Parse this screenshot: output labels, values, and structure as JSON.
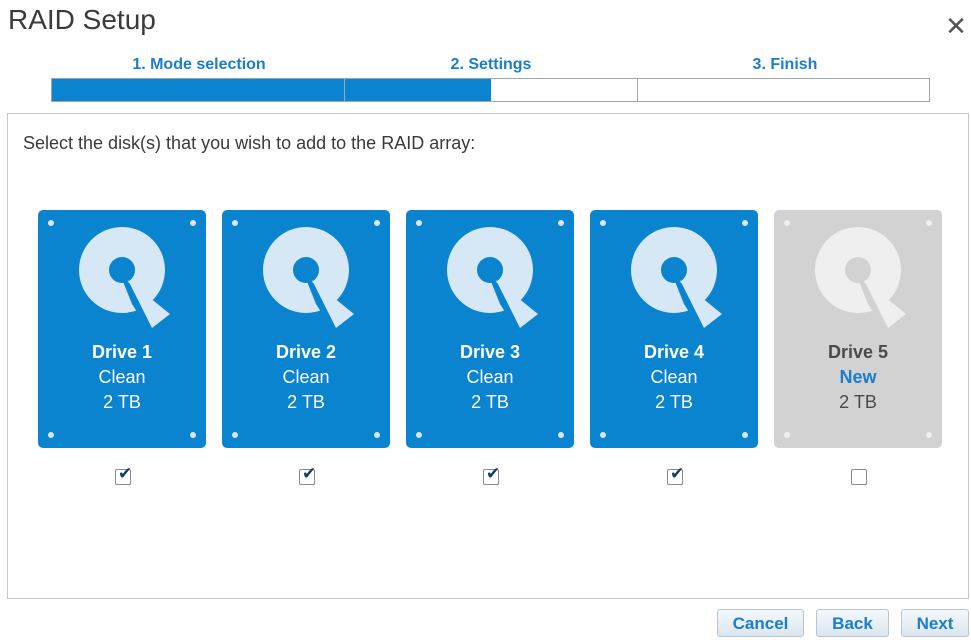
{
  "dialog": {
    "title": "RAID Setup"
  },
  "steps": [
    {
      "label": "1. Mode selection"
    },
    {
      "label": "2. Settings"
    },
    {
      "label": "3. Finish"
    }
  ],
  "progress": {
    "fraction_complete": 0.5
  },
  "instruction": "Select the disk(s) that you wish to add to the RAID array:",
  "drives": [
    {
      "name": "Drive 1",
      "status": "Clean",
      "size": "2 TB",
      "checked": true,
      "color": "#0a84cf"
    },
    {
      "name": "Drive 2",
      "status": "Clean",
      "size": "2 TB",
      "checked": true,
      "color": "#0a84cf"
    },
    {
      "name": "Drive 3",
      "status": "Clean",
      "size": "2 TB",
      "checked": true,
      "color": "#0a84cf"
    },
    {
      "name": "Drive 4",
      "status": "Clean",
      "size": "2 TB",
      "checked": true,
      "color": "#0a84cf"
    },
    {
      "name": "Drive 5",
      "status": "New",
      "size": "2 TB",
      "checked": false,
      "color": "#d2d2d2"
    }
  ],
  "buttons": {
    "cancel": "Cancel",
    "back": "Back",
    "next": "Next"
  },
  "colors": {
    "accent": "#0a84cf",
    "link": "#1a7ecb",
    "checkmark": "#123e66"
  },
  "icons": {
    "close": "close-icon",
    "drive": "hard-disk-icon",
    "check": "checkmark-icon"
  }
}
